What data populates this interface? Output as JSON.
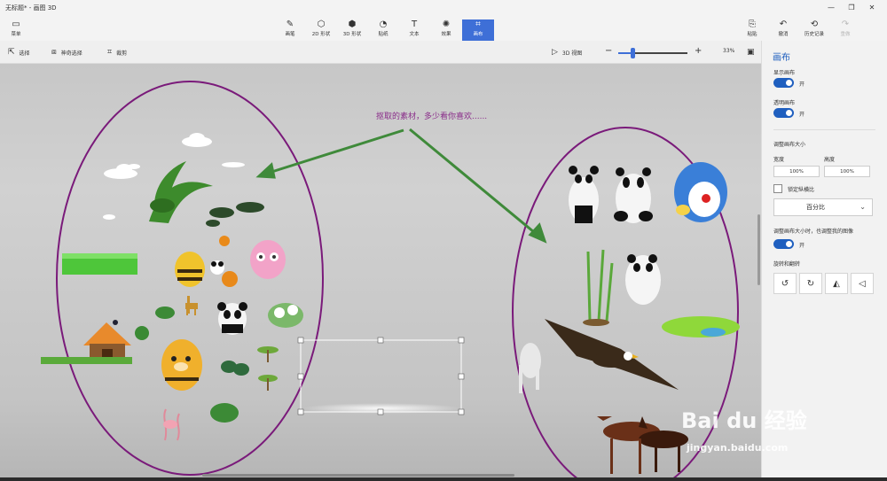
{
  "app": {
    "title": "无标题* - 画图 3D"
  },
  "window_controls": {
    "minimize": "—",
    "maximize": "❐",
    "close": "✕"
  },
  "ribbon": {
    "menu": {
      "label": "菜单",
      "icon": "folder-icon"
    },
    "tools": [
      {
        "label": "画笔",
        "icon": "brush-icon",
        "glyph": "✎"
      },
      {
        "label": "2D 形状",
        "icon": "shape-2d-icon",
        "glyph": "⬡"
      },
      {
        "label": "3D 形状",
        "icon": "cube-icon",
        "glyph": "⬢"
      },
      {
        "label": "贴纸",
        "icon": "sticker-icon",
        "glyph": "◔"
      },
      {
        "label": "文本",
        "icon": "text-icon",
        "glyph": "T"
      },
      {
        "label": "效果",
        "icon": "effects-icon",
        "glyph": "✺"
      },
      {
        "label": "画布",
        "icon": "canvas-icon",
        "glyph": "⌗",
        "active": true
      }
    ],
    "right_tools": [
      {
        "label": "粘贴",
        "icon": "paste-icon",
        "glyph": "⎘"
      },
      {
        "label": "撤消",
        "icon": "undo-icon",
        "glyph": "↶"
      },
      {
        "label": "历史记录",
        "icon": "history-icon",
        "glyph": "⟲"
      },
      {
        "label": "重做",
        "icon": "redo-icon",
        "glyph": "↷",
        "disabled": true
      }
    ]
  },
  "subtoolbar": {
    "select": "选择",
    "magic_select": "神奇选择",
    "crop": "裁剪",
    "view_3d": "3D 视图",
    "zoom_minus": "−",
    "zoom_plus": "+",
    "zoom_level": "33%",
    "zoom_fraction": 0.2
  },
  "canvas": {
    "annotation": "抠取的素材，多少看你喜欢......"
  },
  "panel": {
    "title": "画布",
    "show_canvas": {
      "label": "显示画布",
      "state": "开"
    },
    "transparent_canvas": {
      "label": "透明画布",
      "state": "开"
    },
    "resize_title": "调整画布大小",
    "width_label": "宽度",
    "height_label": "高度",
    "width_value": "100%",
    "height_value": "100%",
    "lock_ratio": "锁定纵横比",
    "unit": "百分比",
    "resize_image": {
      "label": "调整画布大小时，也调整我的图像",
      "state": "开"
    },
    "rotate_title": "旋转和翻转",
    "rotate_buttons": [
      {
        "name": "rotate-left",
        "glyph": "↺"
      },
      {
        "name": "rotate-right",
        "glyph": "↻"
      },
      {
        "name": "flip-vertical",
        "glyph": "◭"
      },
      {
        "name": "flip-horizontal",
        "glyph": "◁"
      }
    ]
  },
  "watermark": {
    "logo": "Bai du 经验",
    "url": "jingyan.baidu.com"
  }
}
